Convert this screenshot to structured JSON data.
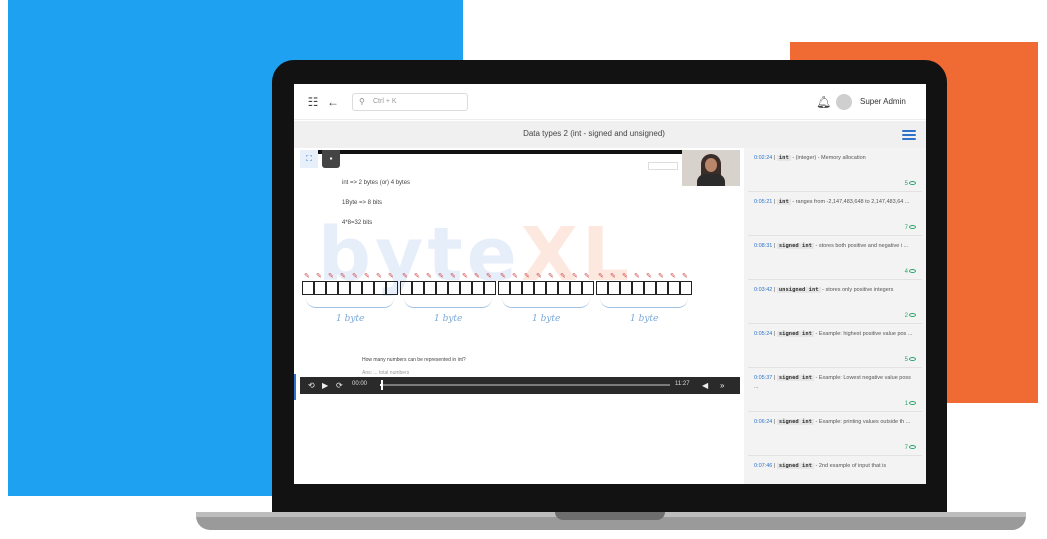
{
  "topbar": {
    "search_placeholder": "Ctrl + K",
    "user_name": "Super Admin"
  },
  "page": {
    "title": "Data types 2 (int - signed and unsigned)"
  },
  "slide": {
    "line1": "int => 2 bytes (or) 4 bytes",
    "line2": "1Byte => 8 bits",
    "line3": "4*8=32 bits",
    "watermark": "byte",
    "watermark_xl": "XL",
    "byte_label": "1 byte",
    "question": "How many numbers can be represented in int?",
    "question_sub": "Ans: ... total numbers"
  },
  "player": {
    "current_time": "00:00",
    "duration": "11:27",
    "progress": 0.01
  },
  "bookmarks": [
    {
      "time": "0:02:24",
      "code": "int",
      "text": " - (integer) - Memory allocation",
      "count": "5"
    },
    {
      "time": "0:05:21",
      "code": "int",
      "text": " - ranges from -2,147,483,648 to 2,147,483,64 ...",
      "count": "7"
    },
    {
      "time": "0:08:31",
      "code": "signed int",
      "text": " - stores both positive and negative i ...",
      "count": "4"
    },
    {
      "time": "0:03:42",
      "code": "unsigned int",
      "text": " - stores only positive integers",
      "count": "2"
    },
    {
      "time": "0:05:24",
      "code": "signed int",
      "text": " - Example: highest positive value pos ...",
      "count": "5"
    },
    {
      "time": "0:05:37",
      "code": "signed int",
      "text": " - Example: Lowest negative value poss ...",
      "count": "1"
    },
    {
      "time": "0:06:24",
      "code": "signed int",
      "text": " - Example: printing values outside th ...",
      "count": "7"
    },
    {
      "time": "0:07:46",
      "code": "signed int",
      "text": " - 2nd example of input that is",
      "count": ""
    }
  ],
  "colors": {
    "accent_blue": "#2e73c9",
    "deco_blue": "#1ea1f1",
    "deco_orange": "#f06a33",
    "view_green": "#2aa46b"
  }
}
